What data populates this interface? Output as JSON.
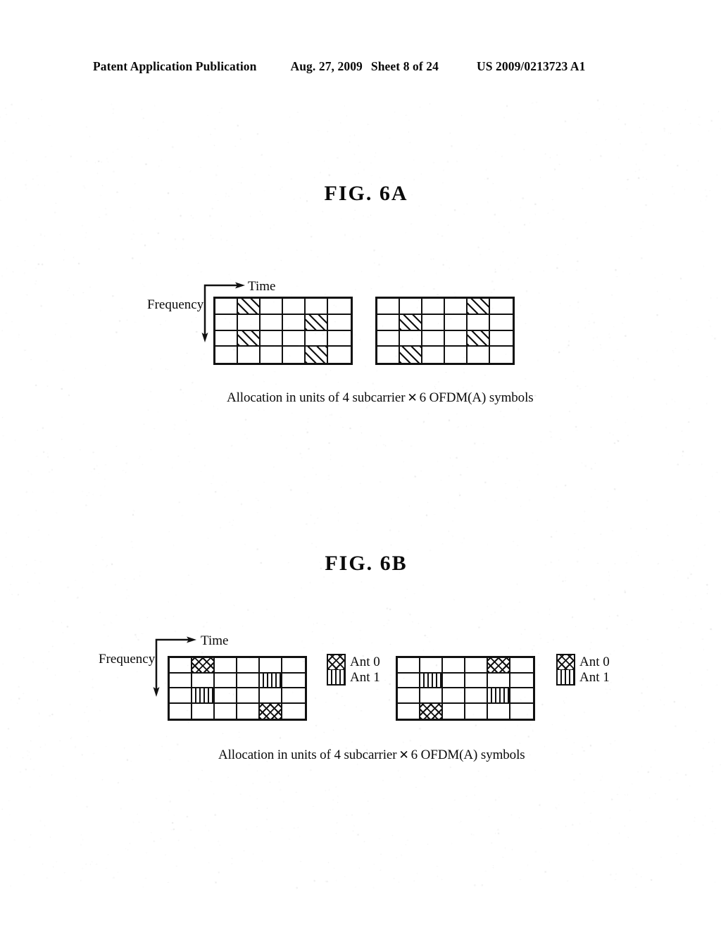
{
  "header": {
    "publication": "Patent Application Publication",
    "date": "Aug. 27, 2009",
    "sheet": "Sheet 8 of 24",
    "patent_number": "US 2009/0213723 A1"
  },
  "figures": [
    {
      "id": "fig6a",
      "title": "FIG. 6A",
      "axis": {
        "frequency": "Frequency",
        "time": "Time"
      },
      "caption": {
        "before": "Allocation in units of 4 subcarrier",
        "symbol": "✕",
        "after": "6 OFDM(A) symbols"
      },
      "grid_size": {
        "columns": 6,
        "rows": 4
      },
      "grids": [
        {
          "name": "grid-left",
          "cells": [
            [
              "empty",
              "diag",
              "empty",
              "empty",
              "empty",
              "empty"
            ],
            [
              "empty",
              "empty",
              "empty",
              "empty",
              "diag",
              "empty"
            ],
            [
              "empty",
              "diag",
              "empty",
              "empty",
              "empty",
              "empty"
            ],
            [
              "empty",
              "empty",
              "empty",
              "empty",
              "diag",
              "empty"
            ]
          ]
        },
        {
          "name": "grid-right",
          "cells": [
            [
              "empty",
              "empty",
              "empty",
              "empty",
              "diag",
              "empty"
            ],
            [
              "empty",
              "diag",
              "empty",
              "empty",
              "empty",
              "empty"
            ],
            [
              "empty",
              "empty",
              "empty",
              "empty",
              "diag",
              "empty"
            ],
            [
              "empty",
              "diag",
              "empty",
              "empty",
              "empty",
              "empty"
            ]
          ]
        }
      ]
    },
    {
      "id": "fig6b",
      "title": "FIG. 6B",
      "axis": {
        "frequency": "Frequency",
        "time": "Time"
      },
      "caption": {
        "before": "Allocation in units of 4 subcarrier",
        "symbol": "✕",
        "after": "6 OFDM(A) symbols"
      },
      "grid_size": {
        "columns": 6,
        "rows": 4
      },
      "grids": [
        {
          "name": "grid-left",
          "cells": [
            [
              "empty",
              "cross",
              "empty",
              "empty",
              "empty",
              "empty"
            ],
            [
              "empty",
              "empty",
              "empty",
              "empty",
              "vert",
              "empty"
            ],
            [
              "empty",
              "vert",
              "empty",
              "empty",
              "empty",
              "empty"
            ],
            [
              "empty",
              "empty",
              "empty",
              "empty",
              "cross",
              "empty"
            ]
          ]
        },
        {
          "name": "grid-right",
          "cells": [
            [
              "empty",
              "empty",
              "empty",
              "empty",
              "cross",
              "empty"
            ],
            [
              "empty",
              "vert",
              "empty",
              "empty",
              "empty",
              "empty"
            ],
            [
              "empty",
              "empty",
              "empty",
              "empty",
              "vert",
              "empty"
            ],
            [
              "empty",
              "cross",
              "empty",
              "empty",
              "empty",
              "empty"
            ]
          ]
        }
      ],
      "legends": [
        {
          "name": "legend-left",
          "ant0": "Ant 0",
          "ant1": "Ant 1"
        },
        {
          "name": "legend-right",
          "ant0": "Ant 0",
          "ant1": "Ant 1"
        }
      ]
    }
  ],
  "colors": {
    "ink": "#111111",
    "paper": "#ffffff"
  }
}
